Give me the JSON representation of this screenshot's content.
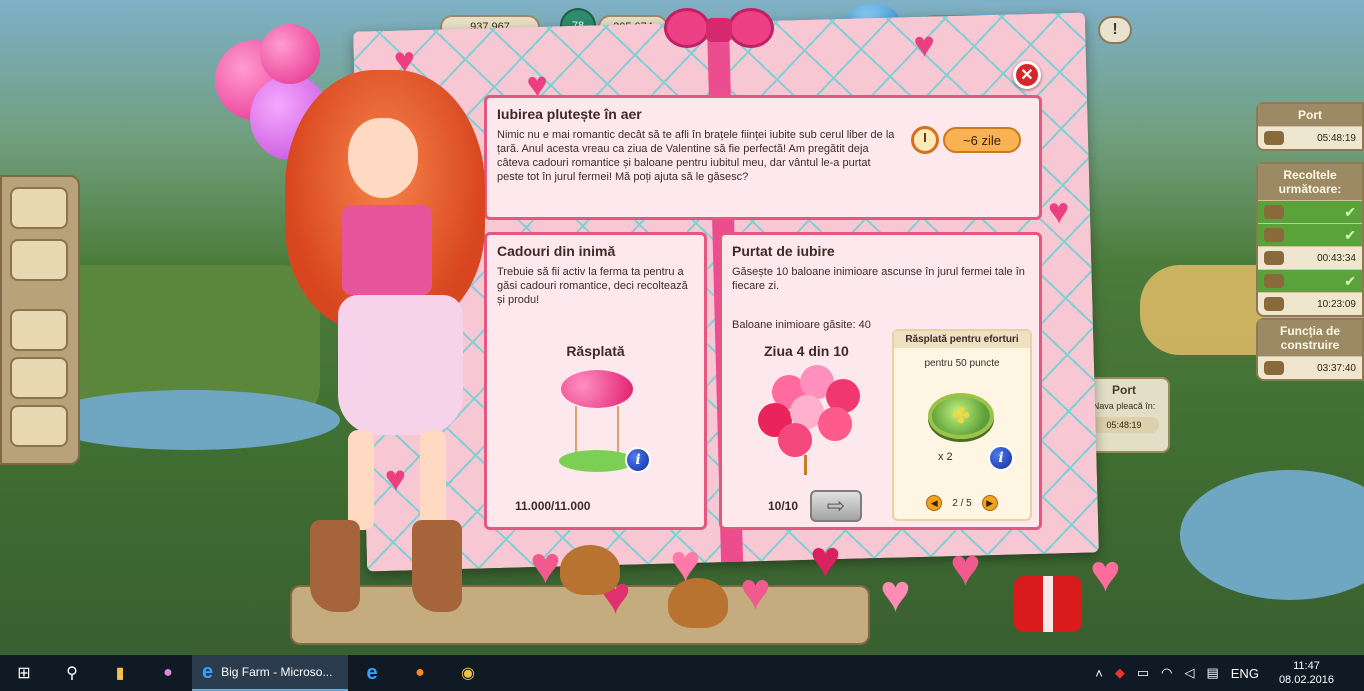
{
  "hud": {
    "coins": "937.967",
    "level": "78",
    "xp": "205.074",
    "hidden_value": "0"
  },
  "dialog": {
    "title": "Iubirea plutește în aer",
    "description": "Nimic nu e mai romantic decât să te afli în brațele ființei iubite sub cerul liber de la țară. Anul acesta vreau ca ziua de Valentine să fie perfectă! Am pregătit deja câteva cadouri romantice și baloane pentru iubitul meu, dar vântul le-a purtat peste tot în jurul fermei! Mă poți ajuta să le găsesc?",
    "timer": "~6 zile",
    "close_label": "✕"
  },
  "gifts_panel": {
    "title": "Cadouri din inimă",
    "text": "Trebuie să fii activ la ferma ta pentru a găsi cadouri romantice, deci recoltează și produ!",
    "reward_label": "Răsplată",
    "progress": "11.000/11.000",
    "info_label": "i"
  },
  "love_panel": {
    "title": "Purtat de iubire",
    "text": "Găsește 10 baloane inimioare ascunse în jurul fermei tale în fiecare zi.",
    "found": "Baloane inimioare găsite: 40",
    "day": "Ziua 4 din 10",
    "progress": "10/10",
    "next_label": "⇨",
    "effort": {
      "header": "Răsplată pentru eforturi",
      "points": "pentru 50 puncte",
      "quantity": "x 2",
      "info_label": "i",
      "pager": "2 / 5",
      "prev_label": "◀",
      "next_label": "▶"
    }
  },
  "right_panel": {
    "port_title": "Port",
    "port_time": "05:48:19",
    "harvest_title": "Recoltele următoare:",
    "harvest_times": [
      "00:43:34",
      "10:23:09"
    ],
    "build_title": "Funcția de construire",
    "build_time": "03:37:40"
  },
  "port_card": {
    "title": "Port",
    "subtitle": "Nava pleacă în:",
    "time": "05:48:19"
  },
  "taskbar": {
    "app_label": "Big Farm - Microso...",
    "language": "ENG",
    "time": "11:47",
    "date": "08.02.2016"
  },
  "colors": {
    "dialog_pink": "#f7c7d3",
    "panel_border": "#e4577e",
    "accent_orange": "#f8b254",
    "close_red": "#d7262a"
  }
}
